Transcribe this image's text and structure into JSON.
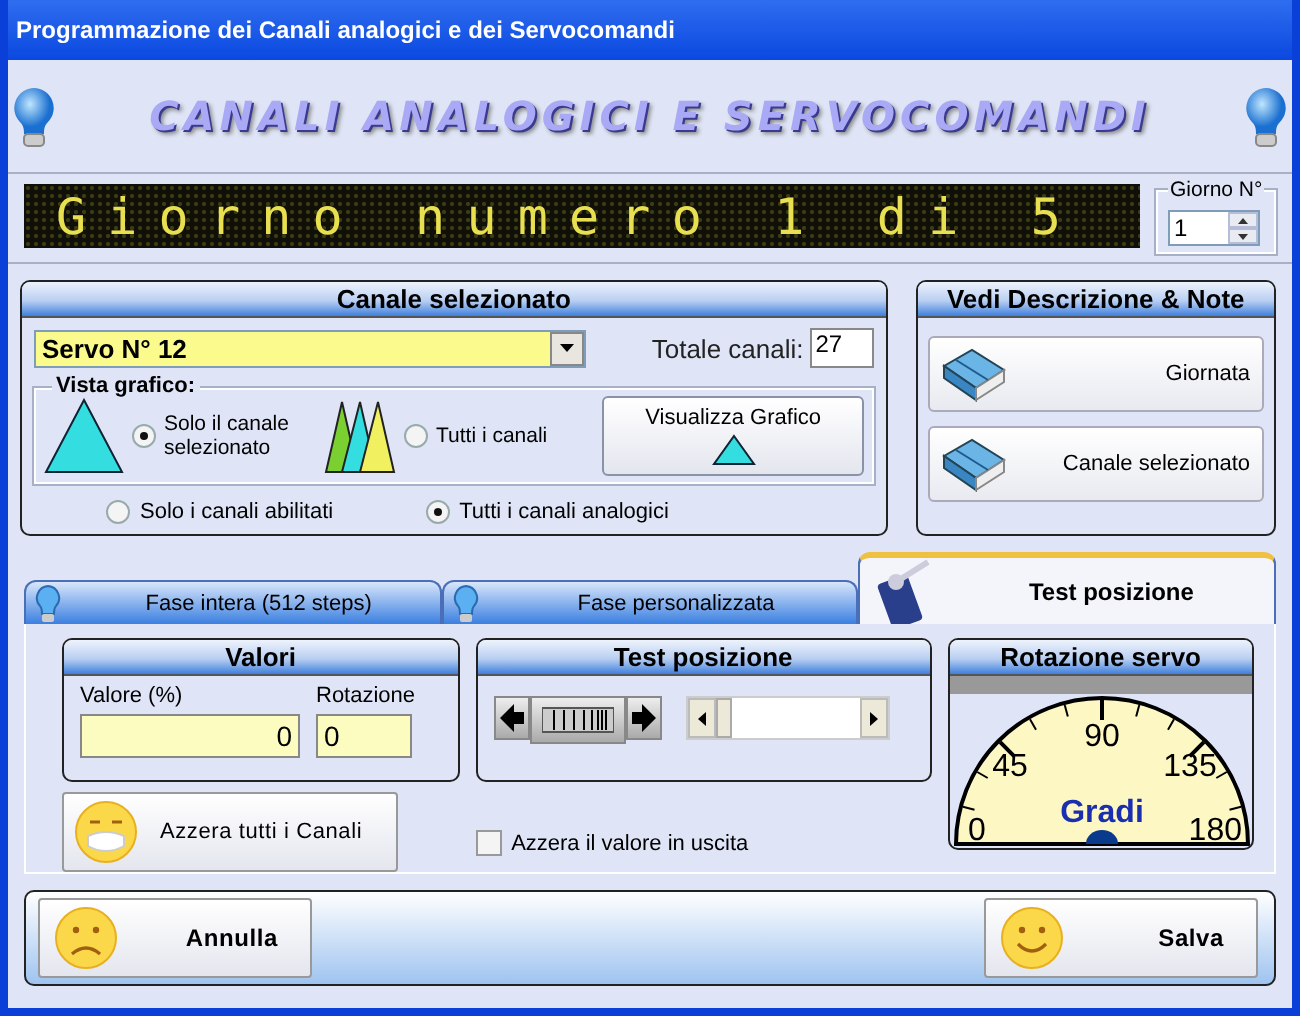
{
  "window": {
    "title": "Programmazione dei Canali analogici e dei Servocomandi"
  },
  "banner": {
    "title": "CANALI ANALOGICI E SERVOCOMANDI"
  },
  "led_display": {
    "text": "Giorno numero 1 di 5"
  },
  "giorno": {
    "label": "Giorno N°",
    "value": "1"
  },
  "canale_panel": {
    "title": "Canale selezionato",
    "servo": "Servo N° 12",
    "total_label": "Totale canali:",
    "total_value": "27",
    "view_label": "Vista grafico:",
    "view_options": [
      {
        "kind": "single",
        "label": "Solo il canale selezionato",
        "selected": true
      },
      {
        "kind": "multi",
        "label": "Tutti i canali",
        "selected": false
      }
    ],
    "chart_button": "Visualizza Grafico",
    "filters": [
      {
        "label": "Solo i canali abilitati",
        "selected": false
      },
      {
        "label": "Tutti i canali analogici",
        "selected": true
      }
    ]
  },
  "notes_panel": {
    "title": "Vedi Descrizione & Note",
    "buttons": [
      "Giornata",
      "Canale selezionato"
    ]
  },
  "tabs": [
    {
      "label": "Fase intera (512 steps)",
      "selected": false
    },
    {
      "label": "Fase personalizzata",
      "selected": false
    },
    {
      "label": "Test posizione",
      "selected": true
    }
  ],
  "valori": {
    "title": "Valori",
    "fields": [
      {
        "label": "Valore (%)",
        "value": "0"
      },
      {
        "label": "Rotazione",
        "value": "0"
      }
    ]
  },
  "reset_button": "Azzera tutti i Canali",
  "test_panel": {
    "title": "Test posizione",
    "slider": {
      "level": 0
    }
  },
  "reset_output": {
    "label": "Azzera il valore in uscita",
    "checked": false
  },
  "rotation_panel": {
    "title": "Rotazione servo",
    "scale": [
      "0",
      "45",
      "90",
      "135",
      "180"
    ],
    "unit": "Gradi"
  },
  "buttons": {
    "cancel": "Annulla",
    "save": "Salva"
  }
}
